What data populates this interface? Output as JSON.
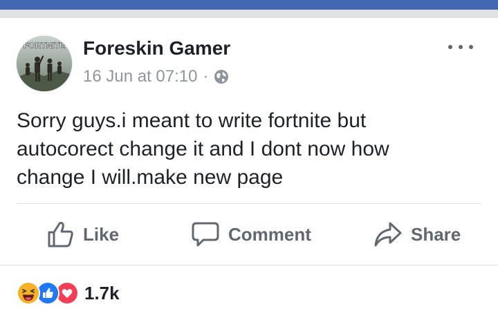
{
  "post": {
    "author": "Foreskin Gamer",
    "timestamp": "16 Jun at 07:10",
    "separator": "·",
    "privacy_icon": "globe-icon",
    "avatar_label": "FORTNITE",
    "text_lines": [
      "Sorry guys.i meant to write fortnite but",
      "autocorect change it and I dont now how",
      "change I will.make new page"
    ]
  },
  "actions": {
    "like": "Like",
    "comment": "Comment",
    "share": "Share"
  },
  "reactions": {
    "types": [
      "haha",
      "like",
      "love"
    ],
    "count": "1.7k"
  },
  "colors": {
    "brand": "#4267b2",
    "like": "#2078f4",
    "love": "#f33e58",
    "haha": "#f7b125",
    "text": "#1d2129",
    "muted": "#90949c",
    "action": "#606770"
  }
}
